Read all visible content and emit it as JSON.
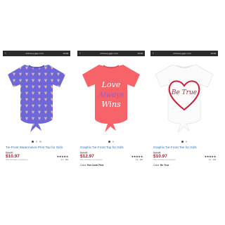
{
  "products": [
    {
      "url": "oldnavy.gap.com",
      "time": "10:08",
      "title": "Tie-Front Watermelon-Print Top for Girls",
      "was_price": "$16.99",
      "price": "$10.97",
      "promo": "35% Off Taken at Checkout",
      "rating_count": "4.6 · 186",
      "color_label": "",
      "color_value": "",
      "colors": {
        "shirt": "#6f67d8"
      }
    },
    {
      "url": "oldnavy.gap.com",
      "time": "10:08",
      "title": "Graphic Tie-Front Top for Girls",
      "was_price": "$16.99",
      "price": "$12.97",
      "promo": "20% Off Taken at Checkout",
      "rating_count": "4.6 · 186",
      "color_label": "Color: ",
      "color_value": "Hot Coral Pink",
      "shirt_text": [
        "Love",
        "Always",
        "Wins"
      ],
      "colors": {
        "shirt": "#f6646a"
      }
    },
    {
      "url": "oldnavy.gap.com",
      "time": "10:08",
      "title": "Graphic Tie-Front Tee for Girls",
      "was_price": "$16.99",
      "price": "$10.97",
      "promo": "35% Off Taken at Checkout",
      "rating_count": "4.7 · 105",
      "color_label": "Color: ",
      "color_value": "Be True",
      "shirt_text": [
        "Be True"
      ],
      "colors": {
        "shirt": "#fbfbfb",
        "accent": "#c8203a"
      }
    }
  ],
  "icons": {
    "back": "chevron-left-icon",
    "star": "star-icon"
  }
}
